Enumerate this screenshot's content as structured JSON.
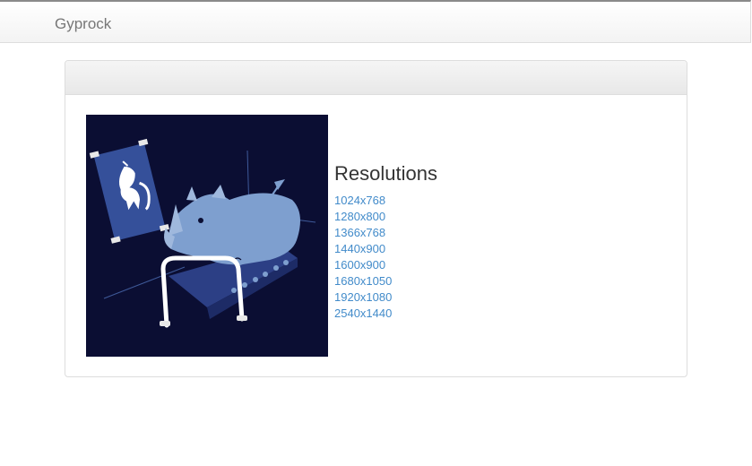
{
  "navbar": {
    "brand": "Gyprock"
  },
  "panel": {
    "heading": "",
    "image_name": "rhino-treadmill-unicorn-wallpaper",
    "resolutions_title": "Resolutions",
    "resolutions": [
      "1024x768",
      "1280x800",
      "1366x768",
      "1440x900",
      "1600x900",
      "1680x1050",
      "1920x1080",
      "2540x1440"
    ]
  },
  "colors": {
    "link": "#428bca",
    "image_background": "#0b0e33",
    "rhino": "#7e9fcf"
  }
}
